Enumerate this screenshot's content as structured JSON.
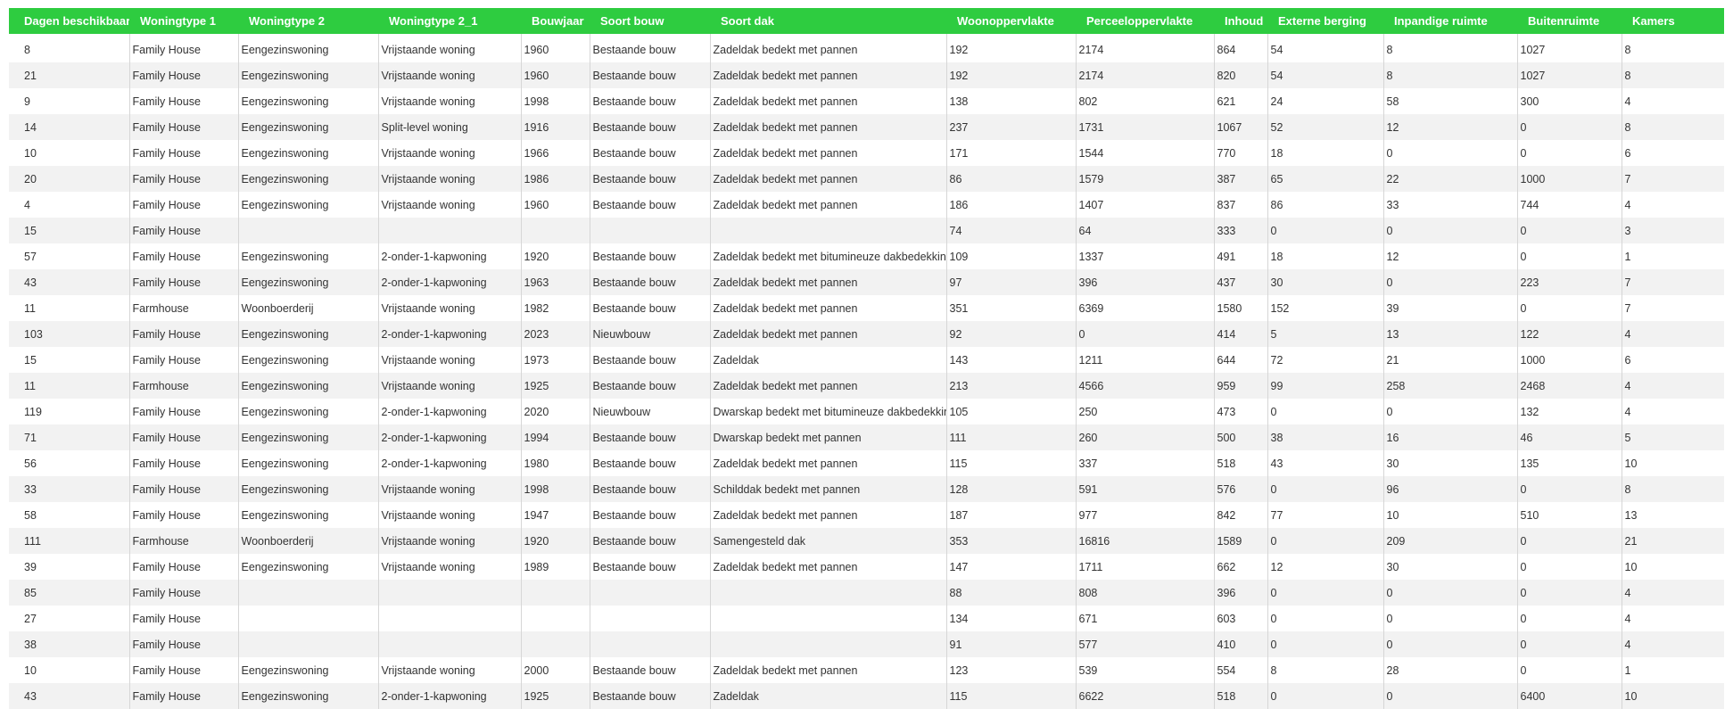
{
  "table": {
    "columns": [
      "Dagen beschikbaar",
      "Woningtype 1",
      "Woningtype 2",
      "Woningtype 2_1",
      "Bouwjaar",
      "Soort bouw",
      "Soort dak",
      "Woonoppervlakte",
      "Perceeloppervlakte",
      "Inhoud",
      "Externe berging",
      "Inpandige ruimte",
      "Buitenruimte",
      "Kamers"
    ],
    "rows": [
      [
        "8",
        "Family House",
        "Eengezinswoning",
        "Vrijstaande woning",
        "1960",
        "Bestaande bouw",
        "Zadeldak bedekt met pannen",
        "192",
        "2174",
        "864",
        "54",
        "8",
        "1027",
        "8"
      ],
      [
        "21",
        "Family House",
        "Eengezinswoning",
        "Vrijstaande woning",
        "1960",
        "Bestaande bouw",
        "Zadeldak bedekt met pannen",
        "192",
        "2174",
        "820",
        "54",
        "8",
        "1027",
        "8"
      ],
      [
        "9",
        "Family House",
        "Eengezinswoning",
        "Vrijstaande woning",
        "1998",
        "Bestaande bouw",
        "Zadeldak bedekt met pannen",
        "138",
        "802",
        "621",
        "24",
        "58",
        "300",
        "4"
      ],
      [
        "14",
        "Family House",
        "Eengezinswoning",
        "Split-level woning",
        "1916",
        "Bestaande bouw",
        "Zadeldak bedekt met pannen",
        "237",
        "1731",
        "1067",
        "52",
        "12",
        "0",
        "8"
      ],
      [
        "10",
        "Family House",
        "Eengezinswoning",
        "Vrijstaande woning",
        "1966",
        "Bestaande bouw",
        "Zadeldak bedekt met pannen",
        "171",
        "1544",
        "770",
        "18",
        "0",
        "0",
        "6"
      ],
      [
        "20",
        "Family House",
        "Eengezinswoning",
        "Vrijstaande woning",
        "1986",
        "Bestaande bouw",
        "Zadeldak bedekt met pannen",
        "86",
        "1579",
        "387",
        "65",
        "22",
        "1000",
        "7"
      ],
      [
        "4",
        "Family House",
        "Eengezinswoning",
        "Vrijstaande woning",
        "1960",
        "Bestaande bouw",
        "Zadeldak bedekt met pannen",
        "186",
        "1407",
        "837",
        "86",
        "33",
        "744",
        "4"
      ],
      [
        "15",
        "Family House",
        "",
        "",
        "",
        "",
        "",
        "74",
        "64",
        "333",
        "0",
        "0",
        "0",
        "3"
      ],
      [
        "57",
        "Family House",
        "Eengezinswoning",
        "2-onder-1-kapwoning",
        "1920",
        "Bestaande bouw",
        "Zadeldak bedekt met bitumineuze dakbedekking",
        "109",
        "1337",
        "491",
        "18",
        "12",
        "0",
        "1"
      ],
      [
        "43",
        "Family House",
        "Eengezinswoning",
        "2-onder-1-kapwoning",
        "1963",
        "Bestaande bouw",
        "Zadeldak bedekt met pannen",
        "97",
        "396",
        "437",
        "30",
        "0",
        "223",
        "7"
      ],
      [
        "11",
        "Farmhouse",
        "Woonboerderij",
        "Vrijstaande woning",
        "1982",
        "Bestaande bouw",
        "Zadeldak bedekt met pannen",
        "351",
        "6369",
        "1580",
        "152",
        "39",
        "0",
        "7"
      ],
      [
        "103",
        "Family House",
        "Eengezinswoning",
        "2-onder-1-kapwoning",
        "2023",
        "Nieuwbouw",
        "Zadeldak bedekt met pannen",
        "92",
        "0",
        "414",
        "5",
        "13",
        "122",
        "4"
      ],
      [
        "15",
        "Family House",
        "Eengezinswoning",
        "Vrijstaande woning",
        "1973",
        "Bestaande bouw",
        "Zadeldak",
        "143",
        "1211",
        "644",
        "72",
        "21",
        "1000",
        "6"
      ],
      [
        "11",
        "Farmhouse",
        "Eengezinswoning",
        "Vrijstaande woning",
        "1925",
        "Bestaande bouw",
        "Zadeldak bedekt met pannen",
        "213",
        "4566",
        "959",
        "99",
        "258",
        "2468",
        "4"
      ],
      [
        "119",
        "Family House",
        "Eengezinswoning",
        "2-onder-1-kapwoning",
        "2020",
        "Nieuwbouw",
        "Dwarskap bedekt met bitumineuze dakbedekking",
        "105",
        "250",
        "473",
        "0",
        "0",
        "132",
        "4"
      ],
      [
        "71",
        "Family House",
        "Eengezinswoning",
        "2-onder-1-kapwoning",
        "1994",
        "Bestaande bouw",
        "Dwarskap bedekt met pannen",
        "111",
        "260",
        "500",
        "38",
        "16",
        "46",
        "5"
      ],
      [
        "56",
        "Family House",
        "Eengezinswoning",
        "2-onder-1-kapwoning",
        "1980",
        "Bestaande bouw",
        "Zadeldak bedekt met pannen",
        "115",
        "337",
        "518",
        "43",
        "30",
        "135",
        "10"
      ],
      [
        "33",
        "Family House",
        "Eengezinswoning",
        "Vrijstaande woning",
        "1998",
        "Bestaande bouw",
        "Schilddak bedekt met pannen",
        "128",
        "591",
        "576",
        "0",
        "96",
        "0",
        "8"
      ],
      [
        "58",
        "Family House",
        "Eengezinswoning",
        "Vrijstaande woning",
        "1947",
        "Bestaande bouw",
        "Zadeldak bedekt met pannen",
        "187",
        "977",
        "842",
        "77",
        "10",
        "510",
        "13"
      ],
      [
        "111",
        "Farmhouse",
        "Woonboerderij",
        "Vrijstaande woning",
        "1920",
        "Bestaande bouw",
        "Samengesteld dak",
        "353",
        "16816",
        "1589",
        "0",
        "209",
        "0",
        "21"
      ],
      [
        "39",
        "Family House",
        "Eengezinswoning",
        "Vrijstaande woning",
        "1989",
        "Bestaande bouw",
        "Zadeldak bedekt met pannen",
        "147",
        "1711",
        "662",
        "12",
        "30",
        "0",
        "10"
      ],
      [
        "85",
        "Family House",
        "",
        "",
        "",
        "",
        "",
        "88",
        "808",
        "396",
        "0",
        "0",
        "0",
        "4"
      ],
      [
        "27",
        "Family House",
        "",
        "",
        "",
        "",
        "",
        "134",
        "671",
        "603",
        "0",
        "0",
        "0",
        "4"
      ],
      [
        "38",
        "Family House",
        "",
        "",
        "",
        "",
        "",
        "91",
        "577",
        "410",
        "0",
        "0",
        "0",
        "4"
      ],
      [
        "10",
        "Family House",
        "Eengezinswoning",
        "Vrijstaande woning",
        "2000",
        "Bestaande bouw",
        "Zadeldak bedekt met pannen",
        "123",
        "539",
        "554",
        "8",
        "28",
        "0",
        "1"
      ],
      [
        "43",
        "Family House",
        "Eengezinswoning",
        "2-onder-1-kapwoning",
        "1925",
        "Bestaande bouw",
        "Zadeldak",
        "115",
        "6622",
        "518",
        "0",
        "0",
        "6400",
        "10"
      ]
    ]
  },
  "colors": {
    "header_bg": "#2ecc40",
    "header_text": "#ffffff",
    "row_alt_bg": "#f2f2f2",
    "grid_line": "#d6d6d6"
  }
}
